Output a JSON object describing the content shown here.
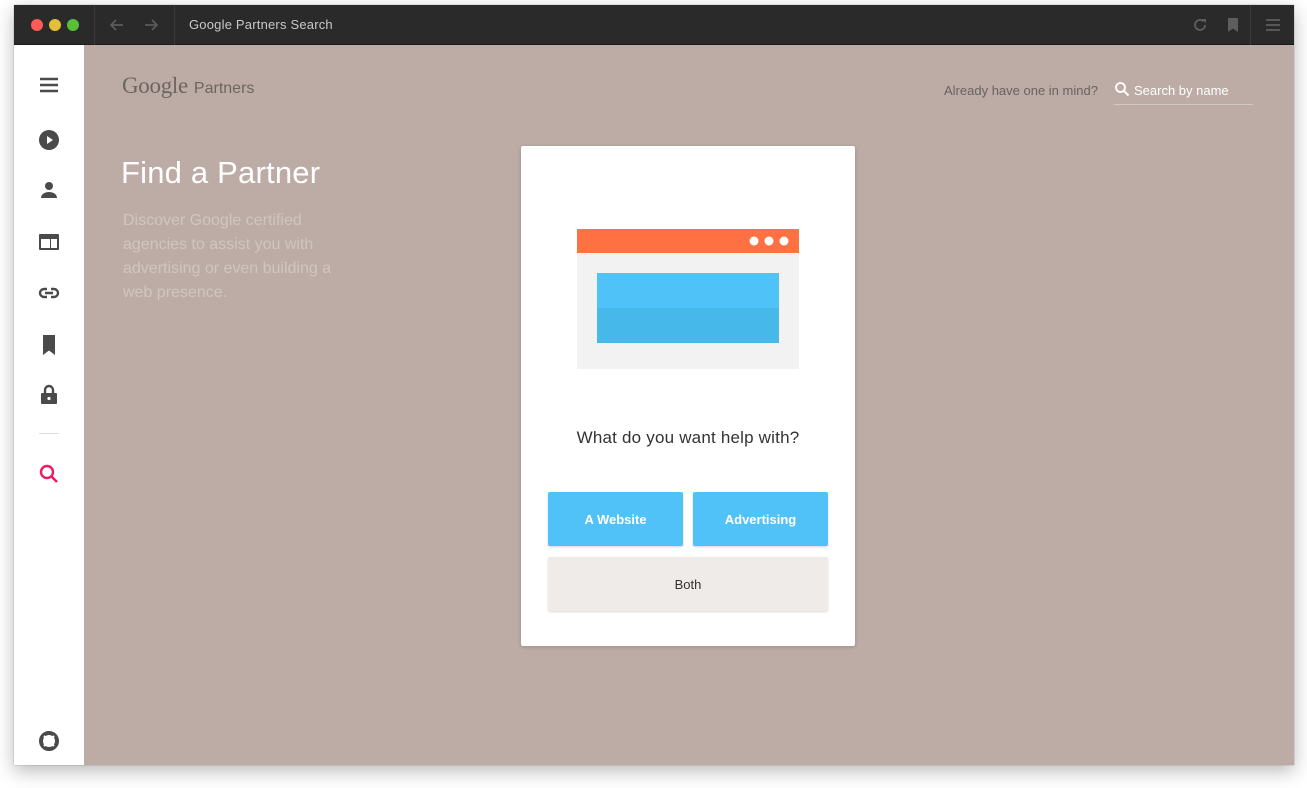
{
  "window": {
    "title": "Google Partners Search"
  },
  "header": {
    "logo_google": "Google",
    "logo_product": "Partners",
    "search_hint": "Already have one in mind?",
    "search_placeholder": "Search by name"
  },
  "hero": {
    "title": "Find a Partner",
    "description": "Discover Google certified agencies to assist you with advertising or even building a web presence."
  },
  "card": {
    "question": "What do you want help with?",
    "options": {
      "website": "A Website",
      "advertising": "Advertising",
      "both": "Both"
    }
  },
  "sidebar": {
    "items": [
      {
        "icon": "menu-icon"
      },
      {
        "icon": "play-circle-icon"
      },
      {
        "icon": "person-icon"
      },
      {
        "icon": "web-browser-icon"
      },
      {
        "icon": "link-icon"
      },
      {
        "icon": "bookmark-icon"
      },
      {
        "icon": "lock-icon"
      },
      {
        "icon": "search-icon",
        "active": true
      },
      {
        "icon": "lifebuoy-icon"
      }
    ]
  },
  "colors": {
    "background": "#bcaca5",
    "accent": "#50c2f7",
    "active_icon": "#e91e63",
    "illustration_bar": "#ff7043"
  }
}
